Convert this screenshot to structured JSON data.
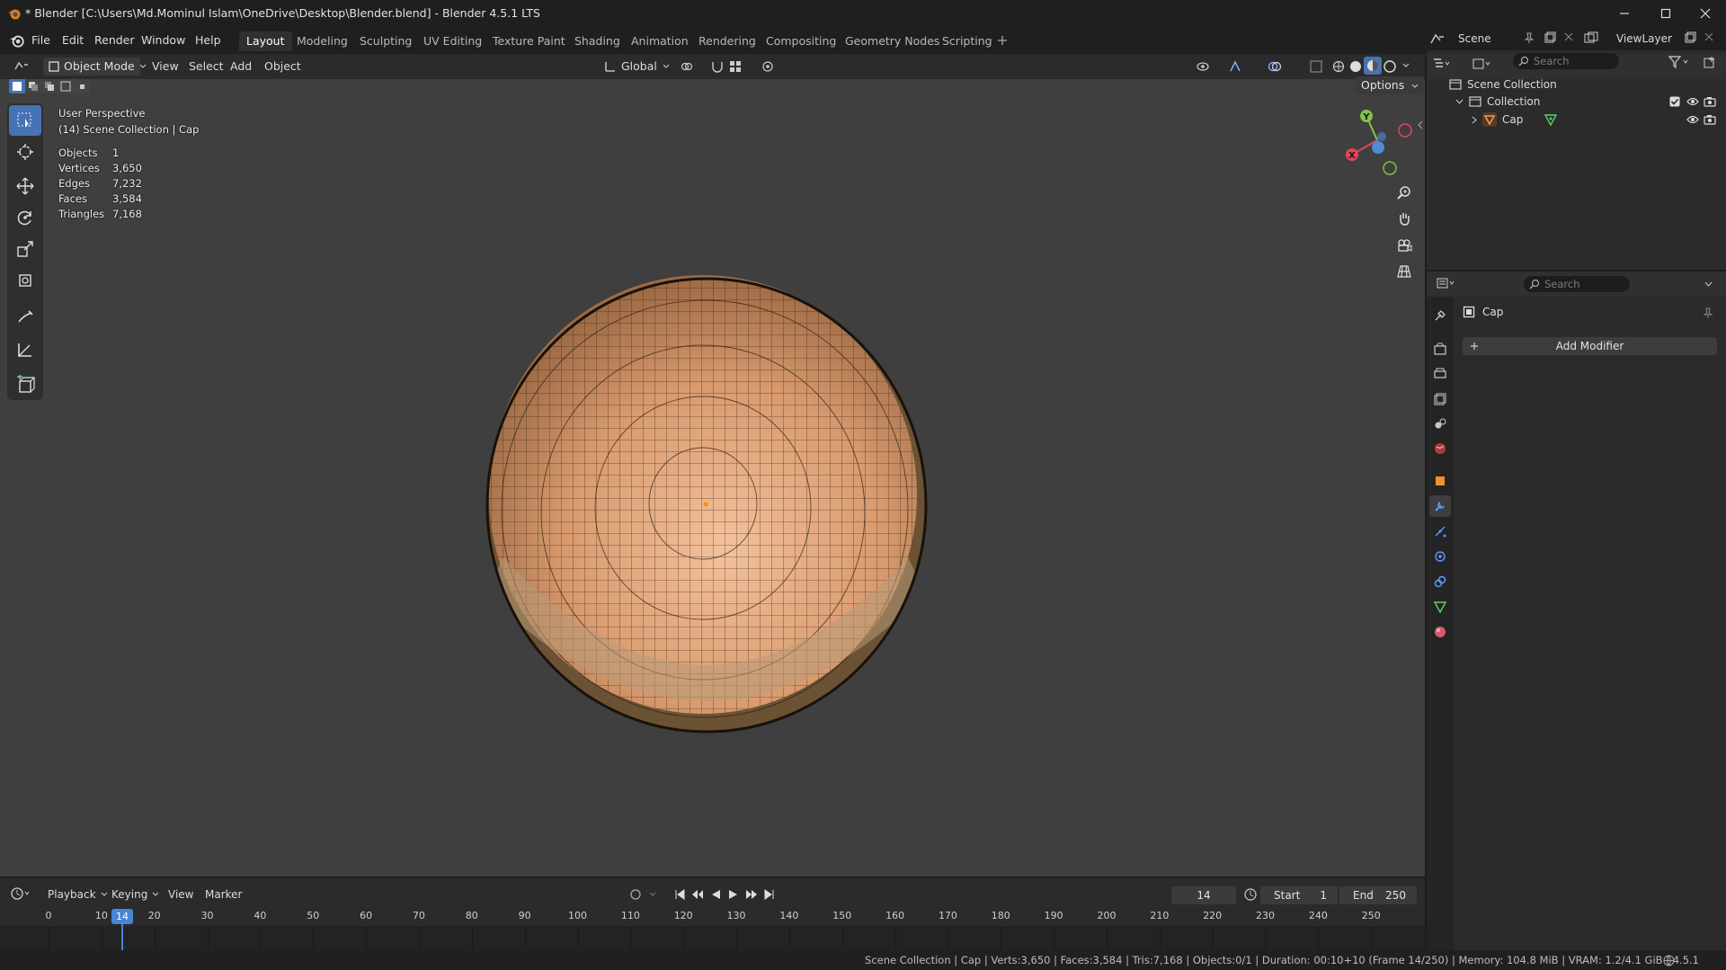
{
  "window": {
    "title": "* Blender [C:\\Users\\Md.Mominul Islam\\OneDrive\\Desktop\\Blender.blend] - Blender 4.5.1 LTS"
  },
  "menus": [
    "File",
    "Edit",
    "Render",
    "Window",
    "Help"
  ],
  "workspaces": [
    "Layout",
    "Modeling",
    "Sculpting",
    "UV Editing",
    "Texture Paint",
    "Shading",
    "Animation",
    "Rendering",
    "Compositing",
    "Geometry Nodes",
    "Scripting"
  ],
  "active_workspace": "Layout",
  "viewport_header": {
    "mode": "Object Mode",
    "menus": [
      "View",
      "Select",
      "Add",
      "Object"
    ],
    "orientation": "Global",
    "options_label": "Options"
  },
  "viewport_overlay": {
    "perspective": "User Perspective",
    "context": "(14) Scene Collection | Cap",
    "stats": [
      {
        "label": "Objects",
        "value": "1"
      },
      {
        "label": "Vertices",
        "value": "3,650"
      },
      {
        "label": "Edges",
        "value": "7,232"
      },
      {
        "label": "Faces",
        "value": "3,584"
      },
      {
        "label": "Triangles",
        "value": "7,168"
      }
    ]
  },
  "gizmo": {
    "x_label": "X",
    "y_label": "Y"
  },
  "scene_selector": {
    "scene": "Scene",
    "view_layer": "ViewLayer"
  },
  "outliner": {
    "search_placeholder": "Search",
    "scene_collection": "Scene Collection",
    "collection": "Collection",
    "object": "Cap"
  },
  "properties": {
    "search_placeholder": "Search",
    "object_name": "Cap",
    "add_modifier": "Add Modifier"
  },
  "timeline": {
    "menus": [
      "Playback",
      "Keying",
      "View",
      "Marker"
    ],
    "current_frame": "14",
    "start_label": "Start",
    "start_value": "1",
    "end_label": "End",
    "end_value": "250",
    "ruler": [
      "0",
      "10",
      "20",
      "30",
      "40",
      "50",
      "60",
      "70",
      "80",
      "90",
      "100",
      "110",
      "120",
      "130",
      "140",
      "150",
      "160",
      "170",
      "180",
      "190",
      "200",
      "210",
      "220",
      "230",
      "240",
      "250"
    ]
  },
  "status_bar": "Scene Collection | Cap | Verts:3,650 | Faces:3,584 | Tris:7,168 | Objects:0/1 | Duration: 00:10+10 (Frame 14/250) | Memory: 104.8 MiB | VRAM: 1.2/4.1 GiB | 4.5.1",
  "colors": {
    "accent": "#4772b3",
    "object_orange": "#e8a060",
    "viewport_bg": "#3f3f3f"
  }
}
